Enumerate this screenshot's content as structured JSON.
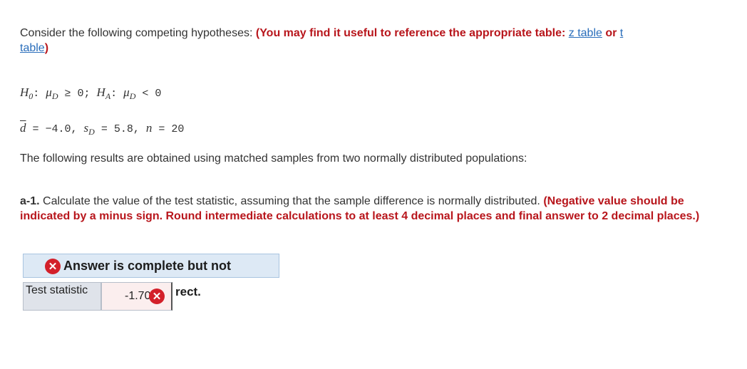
{
  "intro": {
    "lead": "Consider the following competing hypotheses: ",
    "note_open": "(You may find it useful to reference the appropriate table: ",
    "z_link": "z table",
    "or": " or ",
    "t_link_1": "t",
    "t_link_2": "table",
    "note_close": ")"
  },
  "hypotheses": {
    "h0": "H",
    "h0_sub": "0",
    "h0_rest": ": ",
    "mu1": "μ",
    "mu1_sub": "D",
    "h0_cond": " ≥ 0; ",
    "ha": "H",
    "ha_sub": "A",
    "ha_rest": ": ",
    "mu2": "μ",
    "mu2_sub": "D",
    "ha_cond": " < 0"
  },
  "stats": {
    "dbar": "d",
    "d_value": " = −4.0, ",
    "s": "s",
    "s_sub": "D",
    "s_value": " = 5.8, ",
    "n": "n",
    "n_value": " = 20"
  },
  "results_text": "The following results are obtained using matched samples from two normally distributed populations:",
  "question": {
    "id": "a-1.",
    "text": " Calculate the value of the test statistic, assuming that the sample difference is normally distributed. ",
    "instructions": "(Negative value should be indicated by a minus sign. Round intermediate calculations to at least 4 decimal places and final answer to 2 decimal places.)"
  },
  "banner": {
    "text": "Answer is complete but not",
    "icon": "x-circle-icon",
    "color": "#d3202a"
  },
  "answer_table": {
    "label": "Test statistic",
    "value": "-1.70",
    "status_icon": "x-circle-icon"
  },
  "banner_tail": "rect."
}
